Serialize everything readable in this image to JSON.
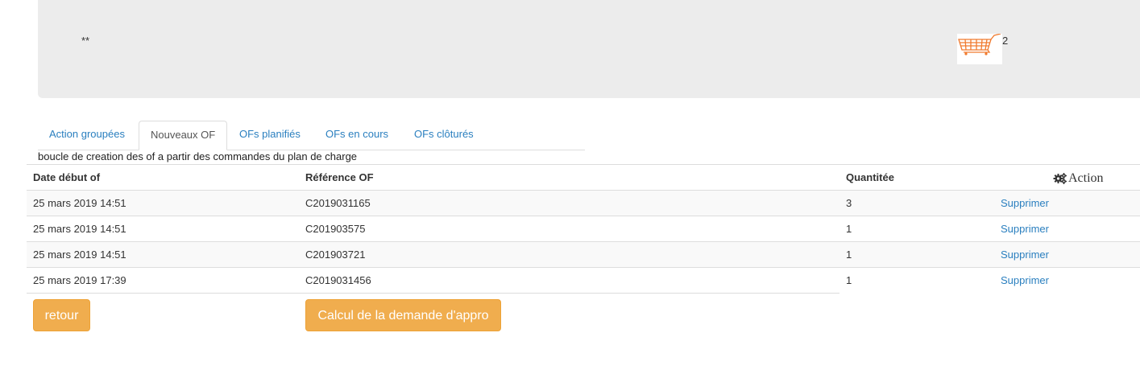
{
  "header": {
    "stars": "**",
    "cart_count": "2"
  },
  "tabs": [
    {
      "label": "Action groupées",
      "active": false
    },
    {
      "label": "Nouveaux OF",
      "active": true
    },
    {
      "label": "OFs planifiés",
      "active": false
    },
    {
      "label": "OFs en cours",
      "active": false
    },
    {
      "label": "OFs clôturés",
      "active": false
    }
  ],
  "description": "boucle de creation des of a partir des commandes du plan de charge",
  "table": {
    "headers": [
      "Date début of",
      "Référence OF",
      "Quantitée",
      "Action"
    ],
    "rows": [
      {
        "date": "25 mars 2019 14:51",
        "ref": "C2019031165",
        "qty": "3",
        "action": "Supprimer"
      },
      {
        "date": "25 mars 2019 14:51",
        "ref": "C201903575",
        "qty": "1",
        "action": "Supprimer"
      },
      {
        "date": "25 mars 2019 14:51",
        "ref": "C201903721",
        "qty": "1",
        "action": "Supprimer"
      },
      {
        "date": "25 mars 2019 17:39",
        "ref": "C2019031456",
        "qty": "1",
        "action": "Supprimer"
      }
    ]
  },
  "buttons": {
    "back": "retour",
    "compute": "Calcul de la demande d'appro"
  },
  "colors": {
    "accent": "#f0ad4e",
    "link": "#2a7fbf",
    "cart_icon": "#f07a2e"
  },
  "icons": {
    "cart": "shopping-cart-icon",
    "action_header": "gears-icon"
  }
}
